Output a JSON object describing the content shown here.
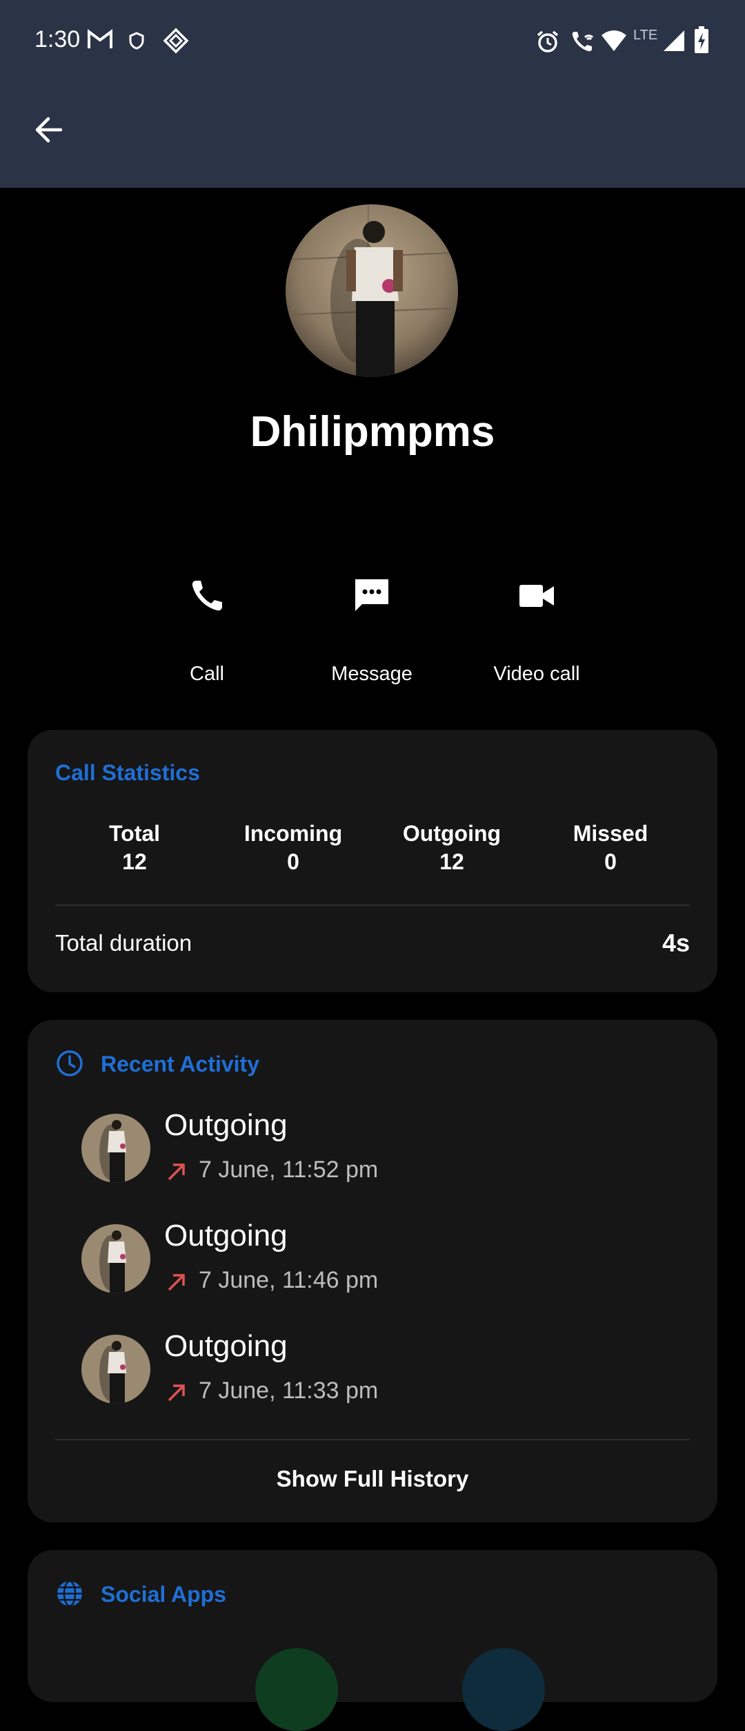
{
  "status_bar": {
    "time": "1:30",
    "icons": [
      "gmail-icon",
      "shield-icon",
      "vpn-icon",
      "alarm-icon",
      "wifi-call-icon",
      "wifi-icon",
      "lte-icon",
      "signal-icon",
      "battery-charging-icon"
    ],
    "network": "LTE"
  },
  "app_bar": {
    "back_icon": "arrow-left-icon"
  },
  "contact": {
    "name": "Dhilipmpms"
  },
  "actions": [
    {
      "label": "Call",
      "icon": "phone-icon"
    },
    {
      "label": "Message",
      "icon": "message-icon"
    },
    {
      "label": "Video call",
      "icon": "video-icon"
    }
  ],
  "call_statistics": {
    "title": "Call Statistics",
    "stats": [
      {
        "label": "Total",
        "value": "12"
      },
      {
        "label": "Incoming",
        "value": "0"
      },
      {
        "label": "Outgoing",
        "value": "12"
      },
      {
        "label": "Missed",
        "value": "0"
      }
    ],
    "duration_label": "Total duration",
    "duration_value": "4s"
  },
  "recent_activity": {
    "title": "Recent Activity",
    "icon": "clock-icon",
    "items": [
      {
        "type": "Outgoing",
        "time": "7 June, 11:52 pm",
        "arrow": "outgoing-arrow-icon"
      },
      {
        "type": "Outgoing",
        "time": "7 June, 11:46 pm",
        "arrow": "outgoing-arrow-icon"
      },
      {
        "type": "Outgoing",
        "time": "7 June, 11:33 pm",
        "arrow": "outgoing-arrow-icon"
      }
    ],
    "show_full": "Show Full History"
  },
  "social_apps": {
    "title": "Social Apps",
    "icon": "globe-icon"
  },
  "colors": {
    "app_bar": "#2b3446",
    "accent": "#1f6fd6",
    "card": "#161616",
    "outgoing_arrow": "#e05252"
  }
}
